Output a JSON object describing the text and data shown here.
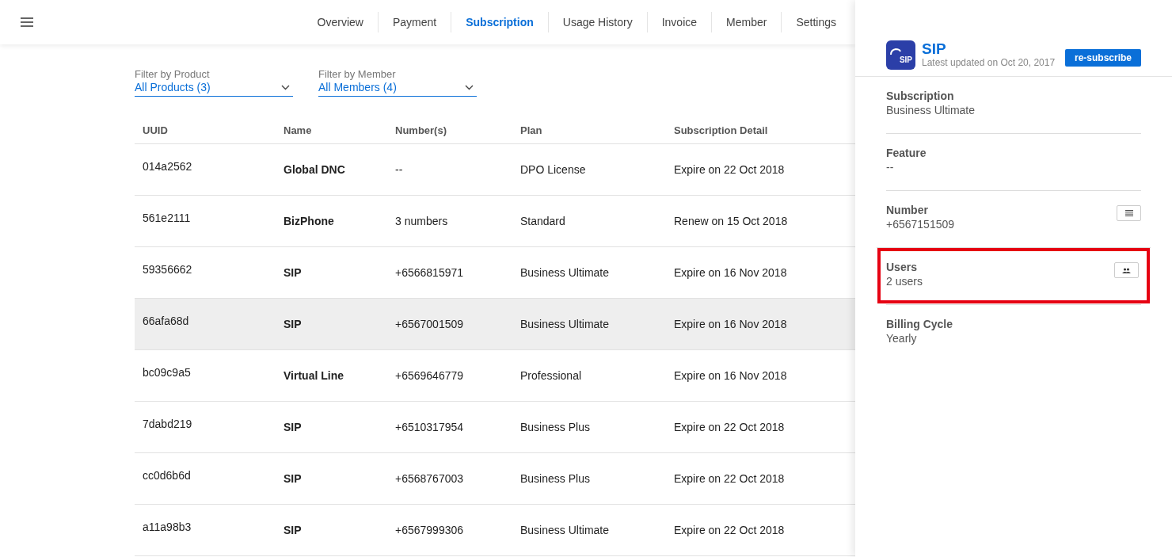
{
  "nav": {
    "tabs": [
      {
        "label": "Overview",
        "selected": false
      },
      {
        "label": "Payment",
        "selected": false
      },
      {
        "label": "Subscription",
        "selected": true
      },
      {
        "label": "Usage History",
        "selected": false
      },
      {
        "label": "Invoice",
        "selected": false
      },
      {
        "label": "Member",
        "selected": false
      },
      {
        "label": "Settings",
        "selected": false
      }
    ]
  },
  "filters": [
    {
      "label": "Filter by Product",
      "value": "All Products (3)"
    },
    {
      "label": "Filter by Member",
      "value": "All Members (4)"
    }
  ],
  "table": {
    "columns": [
      "UUID",
      "Name",
      "Number(s)",
      "Plan",
      "Subscription Detail"
    ],
    "rows": [
      {
        "cells": [
          "014a2562",
          "Global DNC",
          "--",
          "DPO License",
          "Expire on 22 Oct 2018"
        ],
        "selected": false
      },
      {
        "cells": [
          "561e2111",
          "BizPhone",
          "3 numbers",
          "Standard",
          "Renew on 15 Oct 2018"
        ],
        "selected": false
      },
      {
        "cells": [
          "59356662",
          "SIP",
          "+6566815971",
          "Business Ultimate",
          "Expire on 16 Nov 2018"
        ],
        "selected": false
      },
      {
        "cells": [
          "66afa68d",
          "SIP",
          "+6567001509",
          "Business Ultimate",
          "Expire on 16 Nov 2018"
        ],
        "selected": true
      },
      {
        "cells": [
          "bc09c9a5",
          "Virtual Line",
          "+6569646779",
          "Professional",
          "Expire on 16 Nov 2018"
        ],
        "selected": false
      },
      {
        "cells": [
          "7dabd219",
          "SIP",
          "+6510317954",
          "Business Plus",
          "Expire on 22 Oct 2018"
        ],
        "selected": false
      },
      {
        "cells": [
          "cc0d6b6d",
          "SIP",
          "+6568767003",
          "Business Plus",
          "Expire on 22 Oct 2018"
        ],
        "selected": false
      },
      {
        "cells": [
          "a11a98b3",
          "SIP",
          "+6567999306",
          "Business Ultimate",
          "Expire on 22 Oct 2018"
        ],
        "selected": false
      }
    ]
  },
  "panel": {
    "logo_text": "SIP",
    "title": "SIP",
    "updated": "Latest updated on Oct 20, 2017",
    "button": "re-subscribe",
    "details": [
      {
        "label": "Subscription",
        "value": "Business Ultimate",
        "kind": "plain",
        "highlighted": false
      },
      {
        "label": "Feature",
        "value": "--",
        "kind": "plain",
        "highlighted": false
      },
      {
        "label": "Number",
        "value": "+6567151509",
        "kind": "list",
        "highlighted": false
      },
      {
        "label": "Users",
        "value": "2 users",
        "kind": "users",
        "highlighted": true
      },
      {
        "label": "Billing Cycle",
        "value": "Yearly",
        "kind": "plain",
        "highlighted": false
      }
    ]
  }
}
